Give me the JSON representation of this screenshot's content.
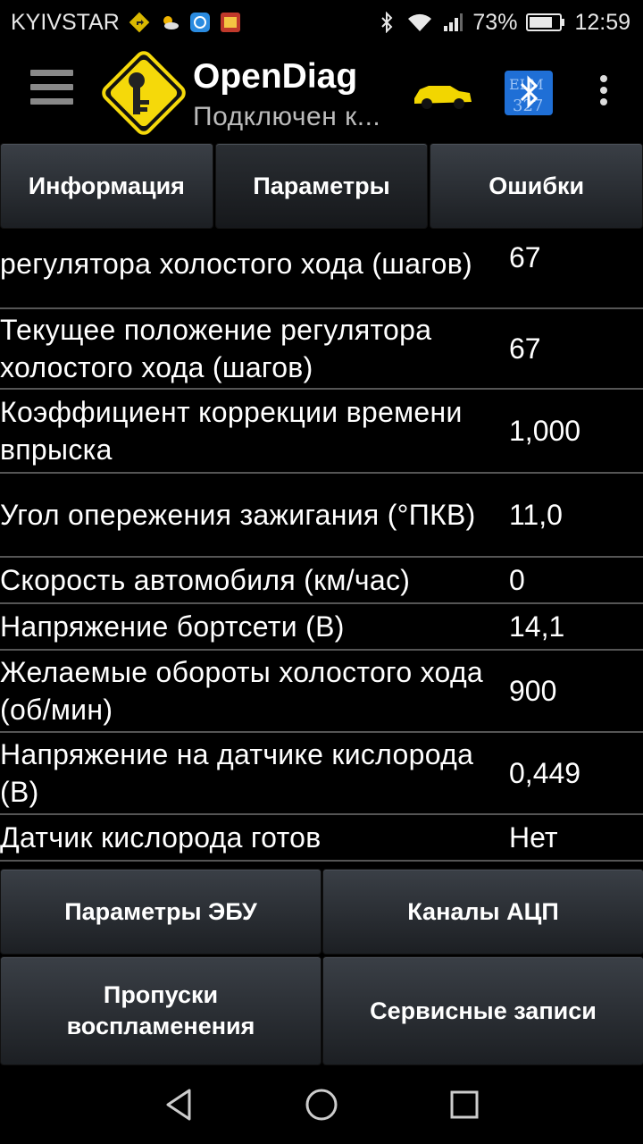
{
  "status_bar": {
    "carrier": "KYIVSTAR",
    "battery": "73%",
    "time": "12:59"
  },
  "app_bar": {
    "title": "OpenDiag",
    "subtitle": "Подключен к..."
  },
  "tabs": [
    {
      "label": "Информация",
      "active": false
    },
    {
      "label": "Параметры",
      "active": true
    },
    {
      "label": "Ошибки",
      "active": false
    }
  ],
  "params": [
    {
      "name": "регулятора холостого хода (шагов)",
      "value": "67"
    },
    {
      "name": "Текущее положение регулятора холостого хода (шагов)",
      "value": "67"
    },
    {
      "name": "Коэффициент коррекции времени впрыска",
      "value": "1,000"
    },
    {
      "name": "Угол опережения зажигания (°ПКВ)",
      "value": "11,0"
    },
    {
      "name": "Скорость автомобиля (км/час)",
      "value": "0"
    },
    {
      "name": "Напряжение бортсети (В)",
      "value": "14,1"
    },
    {
      "name": "Желаемые обороты холостого хода (об/мин)",
      "value": "900"
    },
    {
      "name": "Напряжение на датчике кислорода (В)",
      "value": "0,449"
    },
    {
      "name": "Датчик кислорода готов",
      "value": "Нет"
    }
  ],
  "buttons": {
    "ecu_params": "Параметры ЭБУ",
    "adc_channels": "Каналы АЦП",
    "misfires": "Пропуски воспламенения",
    "service_records": "Сервисные записи"
  },
  "colors": {
    "logo_yellow": "#f5d90a",
    "car_yellow": "#f2d600",
    "bt_blue": "#1f6fd6"
  }
}
